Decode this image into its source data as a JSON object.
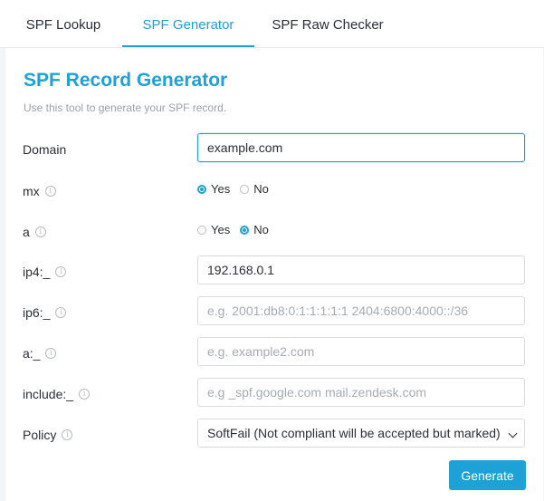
{
  "tabs": [
    {
      "label": "SPF Lookup"
    },
    {
      "label": "SPF Generator"
    },
    {
      "label": "SPF Raw Checker"
    }
  ],
  "header": {
    "title": "SPF Record Generator",
    "subtitle": "Use this tool to generate your SPF record."
  },
  "form": {
    "domain": {
      "label": "Domain",
      "value": "example.com"
    },
    "mx": {
      "label": "mx",
      "options": [
        "Yes",
        "No"
      ],
      "selected": "Yes"
    },
    "a": {
      "label": "a",
      "options": [
        "Yes",
        "No"
      ],
      "selected": "No"
    },
    "ip4": {
      "label": "ip4:_",
      "value": "192.168.0.1",
      "placeholder": ""
    },
    "ip6": {
      "label": "ip6:_",
      "value": "",
      "placeholder": "e.g. 2001:db8:0:1:1:1:1:1 2404:6800:4000::/36"
    },
    "a_mech": {
      "label": "a:_",
      "value": "",
      "placeholder": "e.g. example2.com"
    },
    "include": {
      "label": "include:_",
      "value": "",
      "placeholder": "e.g _spf.google.com mail.zendesk.com"
    },
    "policy": {
      "label": "Policy",
      "selected": "SoftFail (Not compliant will be accepted but marked)"
    }
  },
  "actions": {
    "generate_label": "Generate"
  },
  "colors": {
    "accent": "#1da1d6"
  },
  "icons": {
    "info": "info-circle-icon",
    "dropdown": "chevron-down-icon"
  }
}
